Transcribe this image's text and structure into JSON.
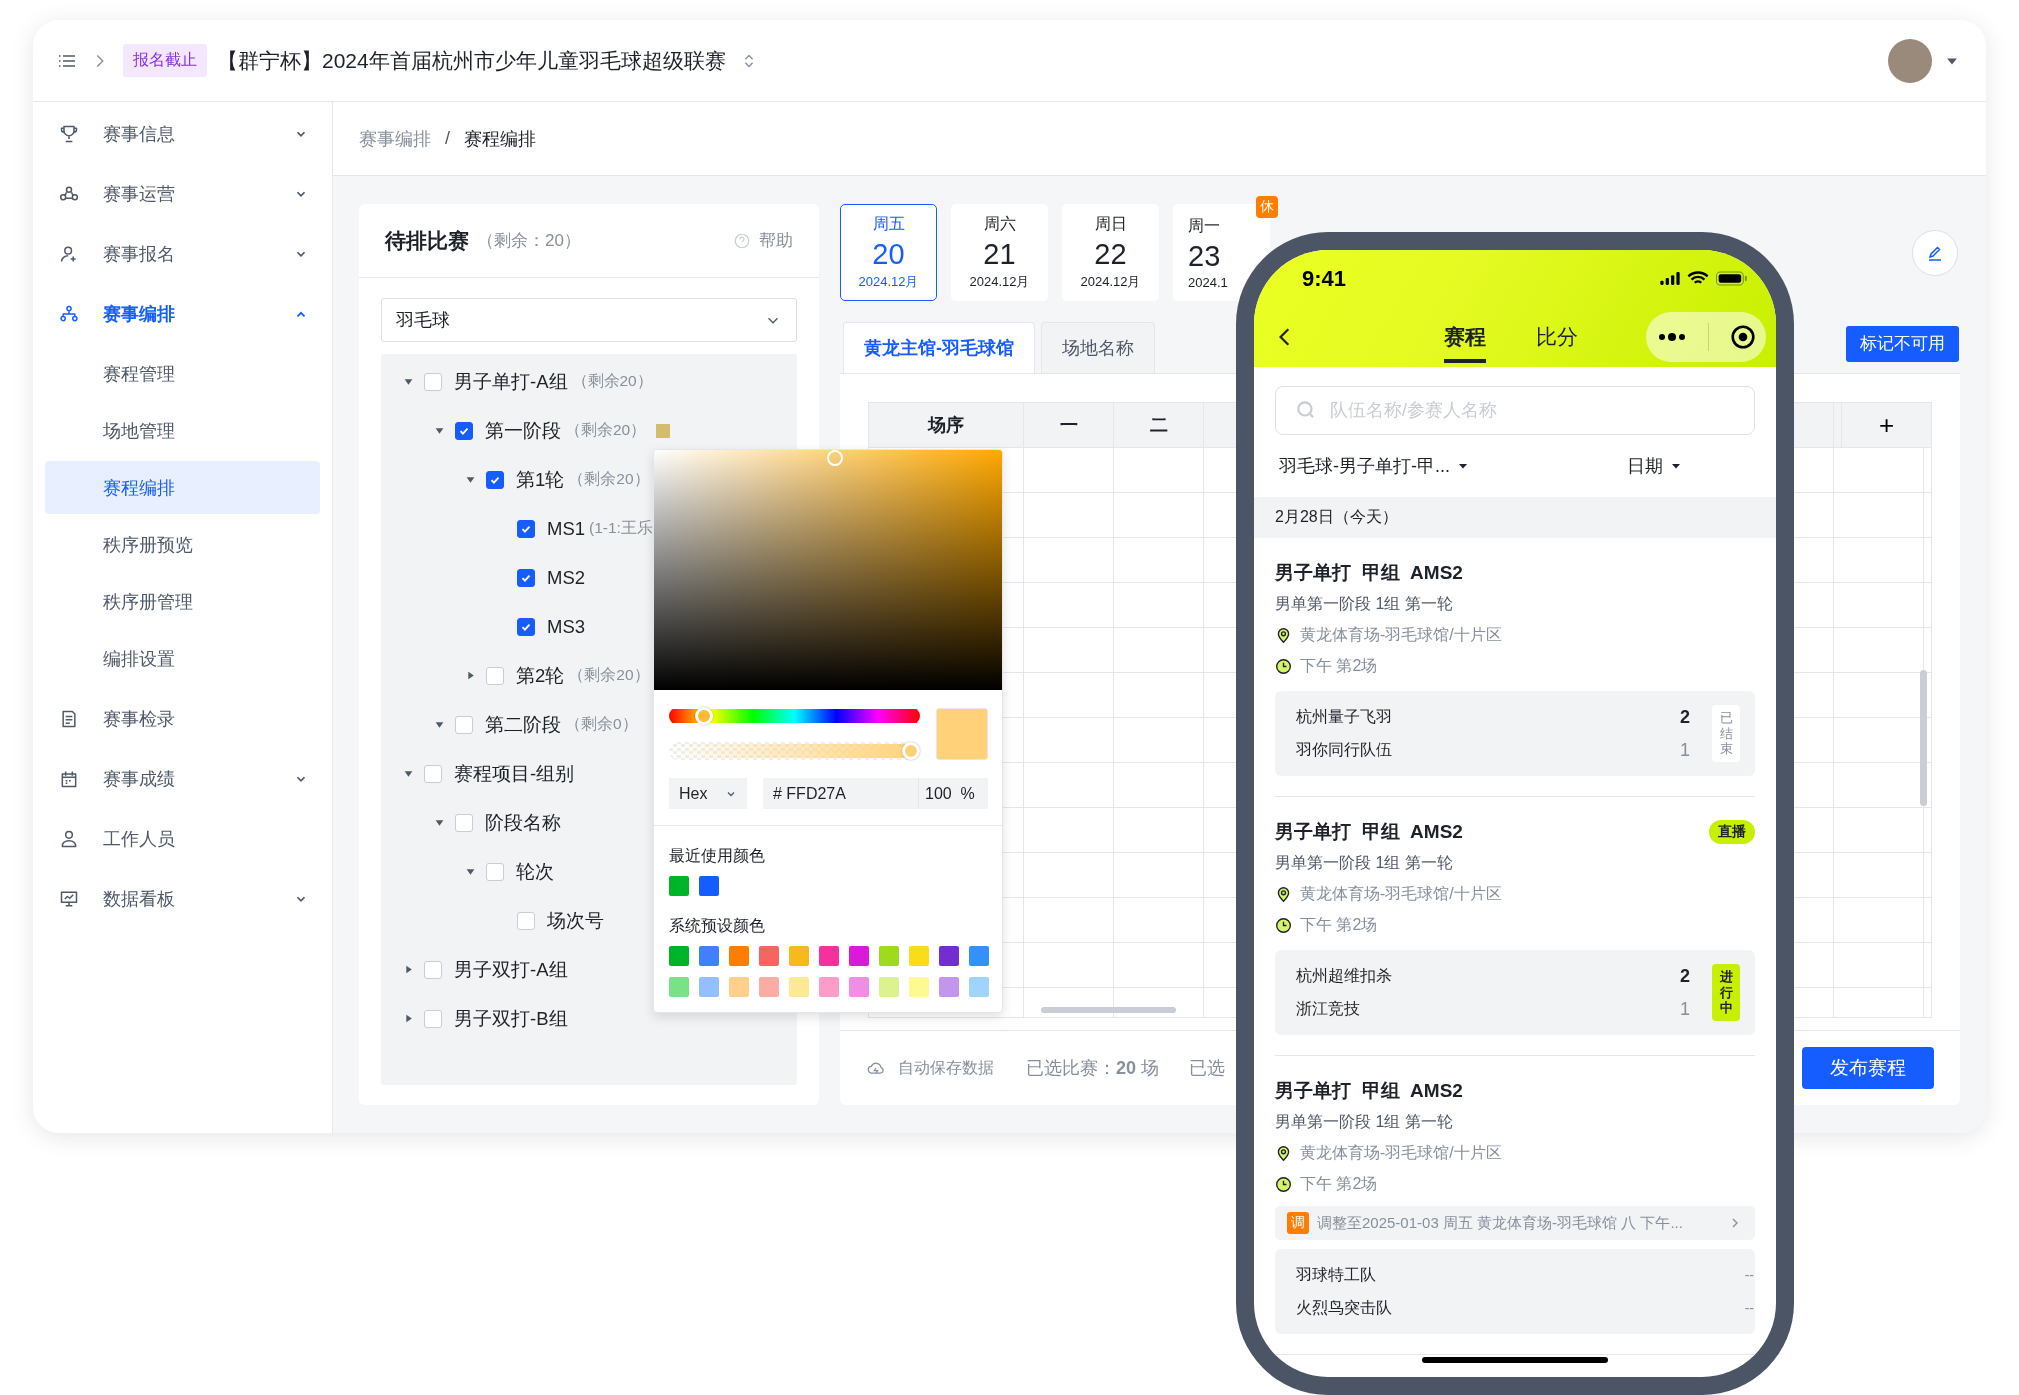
{
  "header": {
    "status_badge": "报名截止",
    "title": "【群宁杯】2024年首届杭州市少年儿童羽毛球超级联赛"
  },
  "sidebar": {
    "items": [
      {
        "label": "赛事信息",
        "selected": false,
        "expanded": false
      },
      {
        "label": "赛事运营",
        "selected": false,
        "expanded": false
      },
      {
        "label": "赛事报名",
        "selected": false,
        "expanded": false
      },
      {
        "label": "赛事编排",
        "selected": true,
        "expanded": true,
        "children": [
          {
            "label": "赛程管理",
            "selected": false
          },
          {
            "label": "场地管理",
            "selected": false
          },
          {
            "label": "赛程编排",
            "selected": true
          },
          {
            "label": "秩序册预览",
            "selected": false
          },
          {
            "label": "秩序册管理",
            "selected": false
          },
          {
            "label": "编排设置",
            "selected": false
          }
        ]
      },
      {
        "label": "赛事检录",
        "selected": false
      },
      {
        "label": "赛事成绩",
        "selected": false,
        "expanded": false
      },
      {
        "label": "工作人员",
        "selected": false
      },
      {
        "label": "数据看板",
        "selected": false,
        "expanded": false
      }
    ]
  },
  "breadcrumb": {
    "items": [
      "赛事编排",
      "赛程编排"
    ],
    "separator": "/"
  },
  "pending_panel": {
    "title": "待排比赛",
    "remaining": "（剩余：20）",
    "help": "帮助",
    "sport_select": "羽毛球",
    "tree": [
      {
        "label": "男子单打-A组",
        "count": "（剩余20）",
        "checked": false,
        "expanded": true,
        "children": [
          {
            "label": "第一阶段",
            "count": "（剩余20）",
            "checked": true,
            "expanded": true,
            "color": "#d4bc6e",
            "children": [
              {
                "label": "第1轮",
                "count": "（剩余20）",
                "checked": true,
                "expanded": true,
                "children": [
                  {
                    "label": "MS1",
                    "count": "(1-1:王乐",
                    "checked": true
                  },
                  {
                    "label": "MS2",
                    "checked": true
                  },
                  {
                    "label": "MS3",
                    "checked": true
                  }
                ]
              },
              {
                "label": "第2轮",
                "count": "（剩余20）",
                "checked": false,
                "expanded": false
              }
            ]
          },
          {
            "label": "第二阶段",
            "count": "（剩余0）",
            "checked": false,
            "expanded": true
          }
        ]
      },
      {
        "label": "赛程项目-组别",
        "checked": false,
        "expanded": true,
        "children": [
          {
            "label": "阶段名称",
            "checked": false,
            "expanded": true,
            "children": [
              {
                "label": "轮次",
                "checked": false,
                "expanded": true,
                "children": [
                  {
                    "label": "场次号",
                    "checked": false
                  }
                ]
              }
            ]
          }
        ]
      },
      {
        "label": "男子双打-A组",
        "checked": false,
        "expanded": false
      },
      {
        "label": "男子双打-B组",
        "checked": false,
        "expanded": false
      }
    ]
  },
  "color_picker": {
    "hue": {
      "level": 0.11
    },
    "alpha": {
      "level": 1
    },
    "format": "Hex",
    "hash": "#",
    "hex": "FFD27A",
    "opacity": "100",
    "percent": "%",
    "recent_title": "最近使用颜色",
    "recent": [
      {
        "color": "#00b42a"
      },
      {
        "color": "#165dff"
      }
    ],
    "preset_title": "系统预设颜色",
    "presets": [
      {
        "color": "#00b42a"
      },
      {
        "color": "#4080ff"
      },
      {
        "color": "#ff7d00"
      },
      {
        "color": "#f76560"
      },
      {
        "color": "#f7ba1e"
      },
      {
        "color": "#f5319d"
      },
      {
        "color": "#d91ad9"
      },
      {
        "color": "#9fdb1d"
      },
      {
        "color": "#fadc19"
      },
      {
        "color": "#722ed1"
      },
      {
        "color": "#3491fa"
      },
      {
        "color": "#7be188"
      },
      {
        "color": "#94bfff"
      },
      {
        "color": "#ffcf8b"
      },
      {
        "color": "#fbaca3"
      },
      {
        "color": "#fce996"
      },
      {
        "color": "#fb9dc7"
      },
      {
        "color": "#f08ee6"
      },
      {
        "color": "#dcf190"
      },
      {
        "color": "#fdfa94"
      },
      {
        "color": "#c396ed"
      },
      {
        "color": "#9fd4fd"
      }
    ]
  },
  "schedule": {
    "date_tabs": [
      {
        "weekday": "周五",
        "day": "20",
        "month": "2024.12月",
        "selected": true
      },
      {
        "weekday": "周六",
        "day": "21",
        "month": "2024.12月",
        "selected": false
      },
      {
        "weekday": "周日",
        "day": "22",
        "month": "2024.12月",
        "selected": false
      },
      {
        "weekday": "周一",
        "day": "23",
        "month": "2024.1",
        "selected": false,
        "badge": "休"
      }
    ],
    "venue_tabs": [
      {
        "label": "黄龙主馆-羽毛球馆",
        "selected": true
      },
      {
        "label": "场地名称",
        "selected": false
      }
    ],
    "mark_button": "标记不可用",
    "columns": [
      "场序",
      "一",
      "二"
    ],
    "add_column": "+",
    "footer": {
      "autosave": "自动保存数据",
      "selected_count": "已选比赛：**20** 场",
      "selected_more": "已选",
      "publish": "发布赛程"
    }
  },
  "phone": {
    "time": "9:41",
    "tabs": [
      {
        "label": "赛程",
        "selected": true
      },
      {
        "label": "比分",
        "selected": false
      }
    ],
    "search": {
      "placeholder": "队伍名称/参赛人名称"
    },
    "filters": [
      "羽毛球-男子单打-甲...",
      "日期"
    ],
    "date_header": "2月28日（今天）",
    "matches": [
      {
        "title": "男子单打  甲组  AMS2",
        "subtitle": "男单第一阶段 1组 第一轮",
        "location": "黄龙体育场-羽毛球馆/十片区",
        "time": "下午 第2场",
        "teams": [
          {
            "name": "杭州量子飞羽",
            "score": "2",
            "winner": true
          },
          {
            "name": "羽你同行队伍",
            "score": "1",
            "winner": false
          }
        ],
        "status": {
          "label": "已结束",
          "kind": "ended"
        }
      },
      {
        "title": "男子单打  甲组  AMS2",
        "badge": "直播",
        "subtitle": "男单第一阶段 1组 第一轮",
        "location": "黄龙体育场-羽毛球馆/十片区",
        "time": "下午 第2场",
        "teams": [
          {
            "name": "杭州超维扣杀",
            "score": "2",
            "winner": true
          },
          {
            "name": "浙江竞技",
            "score": "1",
            "winner": false
          }
        ],
        "status": {
          "label": "进行中",
          "kind": "live"
        }
      },
      {
        "title": "男子单打  甲组  AMS2",
        "subtitle": "男单第一阶段 1组 第一轮",
        "location": "黄龙体育场-羽毛球馆/十片区",
        "time": "下午 第2场",
        "notice": {
          "tag": "调",
          "text": "调整至2025-01-03 周五 黄龙体育场-羽毛球馆 八 下午..."
        },
        "teams": [
          {
            "name": "羽球特工队",
            "score": "--",
            "winner": false
          },
          {
            "name": "火烈鸟突击队",
            "score": "--",
            "winner": false
          }
        ]
      }
    ]
  }
}
